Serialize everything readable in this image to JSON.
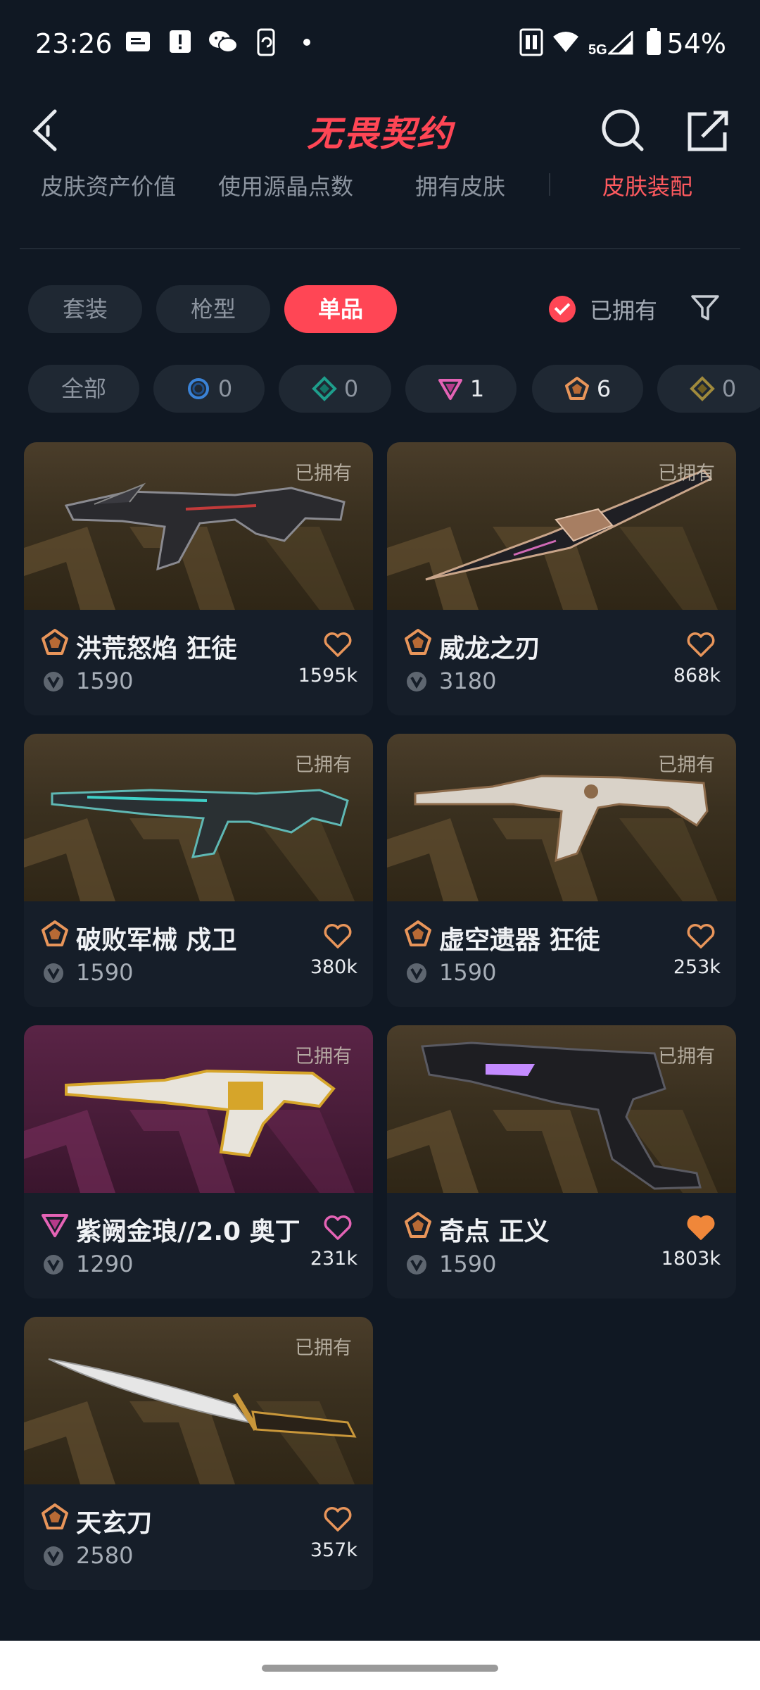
{
  "status_bar": {
    "time": "23:26",
    "network": "5G",
    "battery": "54%"
  },
  "header": {
    "title": "无畏契约"
  },
  "tabs": [
    "皮肤资产价值",
    "使用源晶点数",
    "拥有皮肤",
    "皮肤装配"
  ],
  "filters": {
    "types": [
      "套装",
      "枪型",
      "单品"
    ],
    "owned_label": "已拥有"
  },
  "rarity": {
    "all_label": "全部",
    "counts": [
      "0",
      "0",
      "1",
      "6",
      "0"
    ]
  },
  "cards": [
    {
      "tag": "已拥有",
      "name": "洪荒怒焰 狂徒",
      "price": "1590",
      "likes": "1595k"
    },
    {
      "tag": "已拥有",
      "name": "威龙之刃",
      "price": "3180",
      "likes": "868k"
    },
    {
      "tag": "已拥有",
      "name": "破败军械 戍卫",
      "price": "1590",
      "likes": "380k"
    },
    {
      "tag": "已拥有",
      "name": "虚空遗器 狂徒",
      "price": "1590",
      "likes": "253k"
    },
    {
      "tag": "已拥有",
      "name": "紫阙金琅//2.0 奥丁",
      "price": "1290",
      "likes": "231k"
    },
    {
      "tag": "已拥有",
      "name": "奇点 正义",
      "price": "1590",
      "likes": "1803k"
    },
    {
      "tag": "已拥有",
      "name": "天玄刀",
      "price": "2580",
      "likes": "357k"
    }
  ],
  "colors": {
    "accent": "#ff4655",
    "background": "#101823",
    "premium_tier": "#e8955a",
    "exclusive_tier": "#e463b5"
  }
}
